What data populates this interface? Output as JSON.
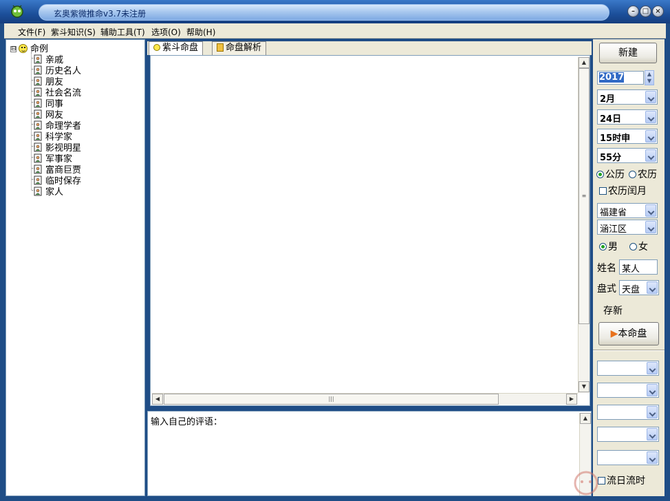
{
  "window": {
    "title": "玄奥紫微推命v3.7未注册"
  },
  "menu": [
    {
      "label": "文件(F)"
    },
    {
      "label": "紫斗知识(S)"
    },
    {
      "label": "辅助工具(T)"
    },
    {
      "label": "选项(O)"
    },
    {
      "label": "帮助(H)"
    }
  ],
  "tree": {
    "expander": "⊟",
    "root": "命例",
    "items": [
      "亲戚",
      "历史名人",
      "朋友",
      "社会名流",
      "同事",
      "网友",
      "命理学者",
      "科学家",
      "影视明星",
      "军事家",
      "富商巨贾",
      "临时保存",
      "家人"
    ]
  },
  "tabs": [
    {
      "label": "紫斗命盘"
    },
    {
      "label": "命盘解析"
    }
  ],
  "comment": {
    "label": "输入自己的评语："
  },
  "right": {
    "new_button": "新建",
    "year": "2017",
    "month": "2月",
    "day": "24日",
    "hour": "15时申",
    "minute": "55分",
    "calendar_solar": "公历",
    "calendar_lunar": "农历",
    "leap_month": "农历闰月",
    "province": "福建省",
    "district": "涵江区",
    "male": "男",
    "female": "女",
    "name_label": "姓名",
    "name_value": "某人",
    "style_label": "盘式",
    "style_value": "天盘",
    "save_new": "存新",
    "this_chart_button": "本命盘",
    "flow_day": "流日流时"
  },
  "colors": {
    "titlebar": "#1c4f9a",
    "panel": "#ece9d8",
    "border": "#7f9db9"
  }
}
